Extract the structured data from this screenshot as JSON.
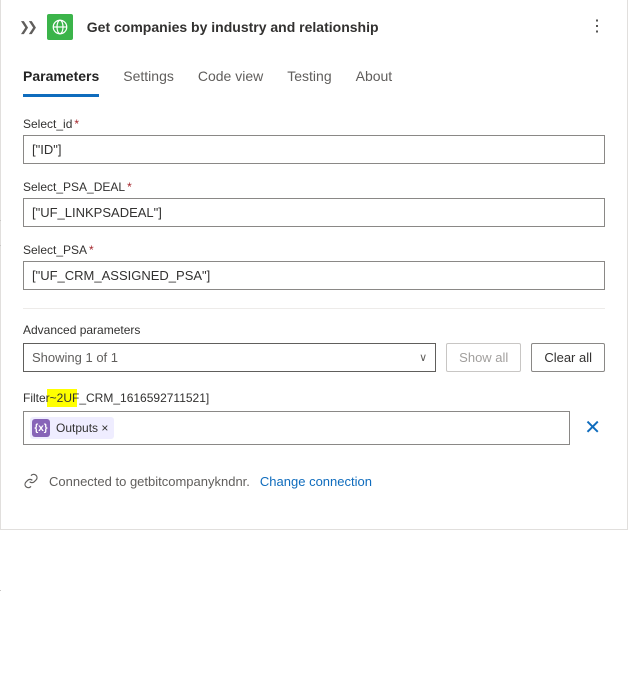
{
  "header": {
    "title": "Get companies by industry and relationship"
  },
  "tabs": {
    "parameters": "Parameters",
    "settings": "Settings",
    "codeview": "Code view",
    "testing": "Testing",
    "about": "About"
  },
  "fields": {
    "select_id": {
      "label": "Select_id",
      "value": "[\"ID\"]"
    },
    "select_psa_deal": {
      "label": "Select_PSA_DEAL",
      "value": "[\"UF_LINKPSADEAL\"]"
    },
    "select_psa": {
      "label": "Select_PSA",
      "value": "[\"UF_CRM_ASSIGNED_PSA\"]"
    }
  },
  "advanced": {
    "heading": "Advanced parameters",
    "showing": "Showing 1 of 1",
    "show_all": "Show all",
    "clear_all": "Clear all"
  },
  "filter": {
    "label": "Filter~2UF_CRM_1616592711521]",
    "token": "Outputs ×"
  },
  "connection": {
    "text": "Connected to getbitcompanykndnr.",
    "change": "Change connection"
  }
}
